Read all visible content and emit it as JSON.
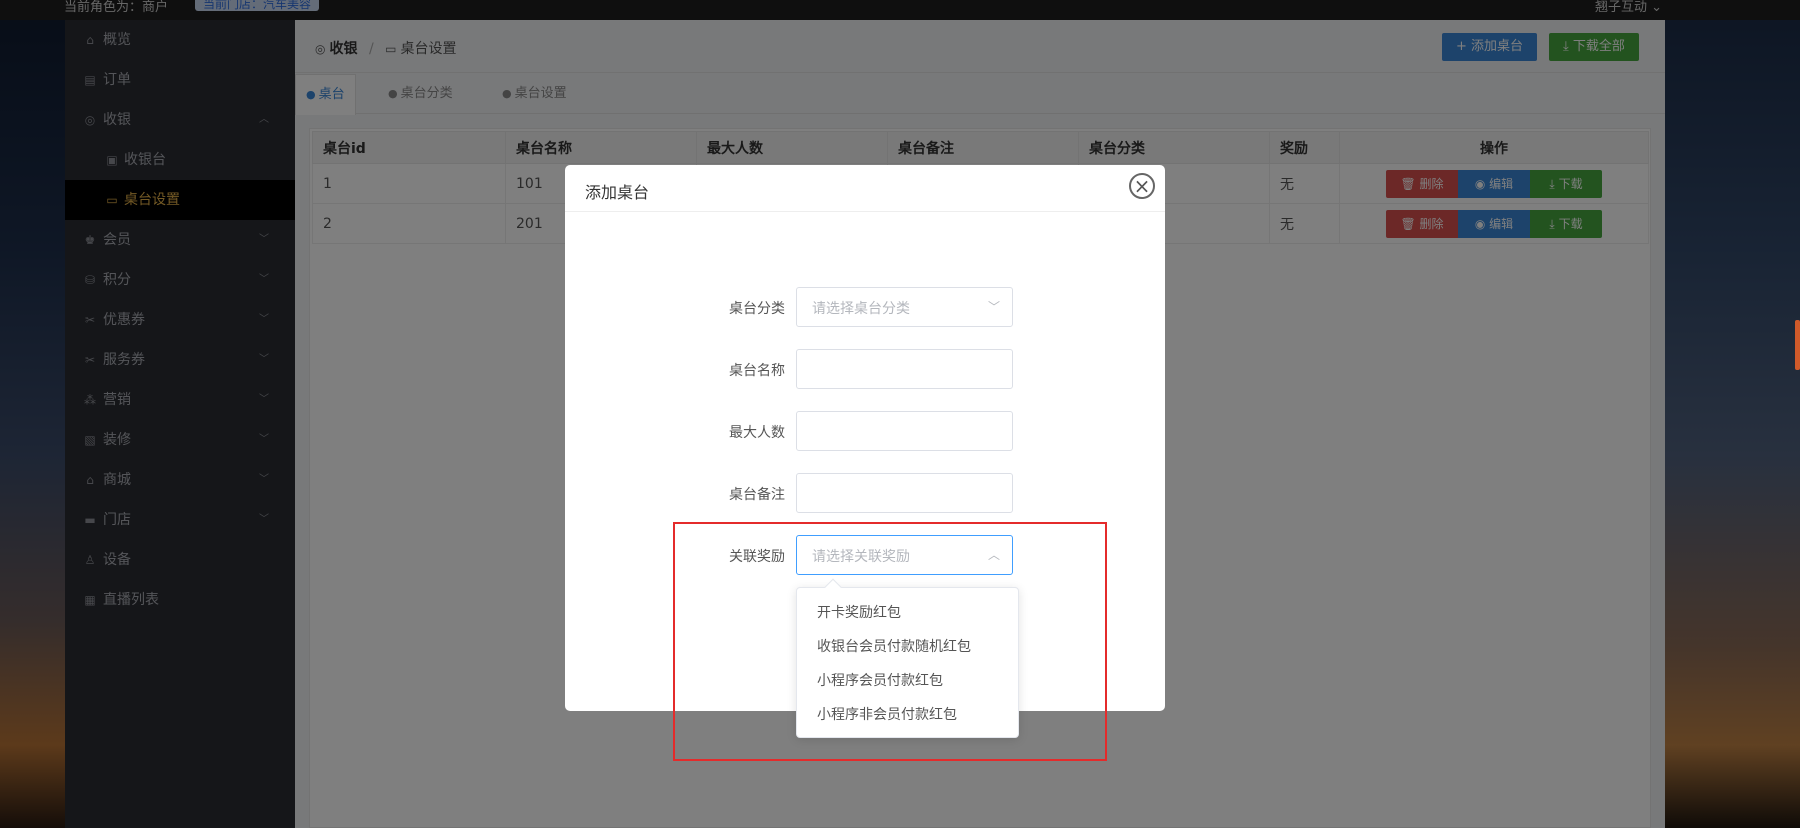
{
  "topbar": {
    "role": "当前角色为：商户",
    "store": "当前门店：汽车美容",
    "user": "翘子互动"
  },
  "sidebar": {
    "items": [
      {
        "label": "概览",
        "icon": "home-icon"
      },
      {
        "label": "订单",
        "icon": "order-icon"
      },
      {
        "label": "收银",
        "icon": "cashier-icon",
        "expanded": true
      },
      {
        "label": "收银台",
        "icon": "register-icon",
        "sub": true
      },
      {
        "label": "桌台设置",
        "icon": "table-icon",
        "sub": true,
        "active": true
      },
      {
        "label": "会员",
        "icon": "member-icon"
      },
      {
        "label": "积分",
        "icon": "points-icon"
      },
      {
        "label": "优惠券",
        "icon": "coupon-icon"
      },
      {
        "label": "服务券",
        "icon": "service-coupon-icon"
      },
      {
        "label": "营销",
        "icon": "marketing-icon"
      },
      {
        "label": "装修",
        "icon": "decoration-icon"
      },
      {
        "label": "商城",
        "icon": "shop-icon"
      },
      {
        "label": "门店",
        "icon": "store-icon"
      },
      {
        "label": "设备",
        "icon": "device-icon"
      },
      {
        "label": "直播列表",
        "icon": "live-icon"
      }
    ]
  },
  "header": {
    "crumb_root": "收银",
    "crumb_sep": "/",
    "crumb_current": "桌台设置",
    "add_button": "+ 添加桌台",
    "download_all_button": "⤓ 下载全部"
  },
  "tabs": [
    {
      "label": "桌台",
      "active": true
    },
    {
      "label": "桌台分类"
    },
    {
      "label": "桌台设置"
    }
  ],
  "table": {
    "columns": [
      "桌台id",
      "桌台名称",
      "最大人数",
      "桌台备注",
      "桌台分类",
      "奖励",
      "操作"
    ],
    "rows": [
      {
        "id": "1",
        "name": "101",
        "reward": "无"
      },
      {
        "id": "2",
        "name": "201",
        "reward": "无"
      }
    ],
    "actions": {
      "delete": "删除",
      "edit": "编辑",
      "download": "下载"
    }
  },
  "modal": {
    "title": "添加桌台",
    "close": "×",
    "fields": {
      "category_label": "桌台分类",
      "category_placeholder": "请选择桌台分类",
      "name_label": "桌台名称",
      "max_label": "最大人数",
      "remark_label": "桌台备注",
      "reward_label": "关联奖励",
      "reward_placeholder": "请选择关联奖励"
    }
  },
  "dropdown": {
    "options": [
      "开卡奖励红包",
      "收银台会员付款随机红包",
      "小程序会员付款红包",
      "小程序非会员付款红包"
    ]
  },
  "colors": {
    "primary": "#3a86d6",
    "success": "#46a73e",
    "danger": "#d9514e",
    "active_menu": "#e7b34a",
    "highlight": "#e42b2b"
  }
}
